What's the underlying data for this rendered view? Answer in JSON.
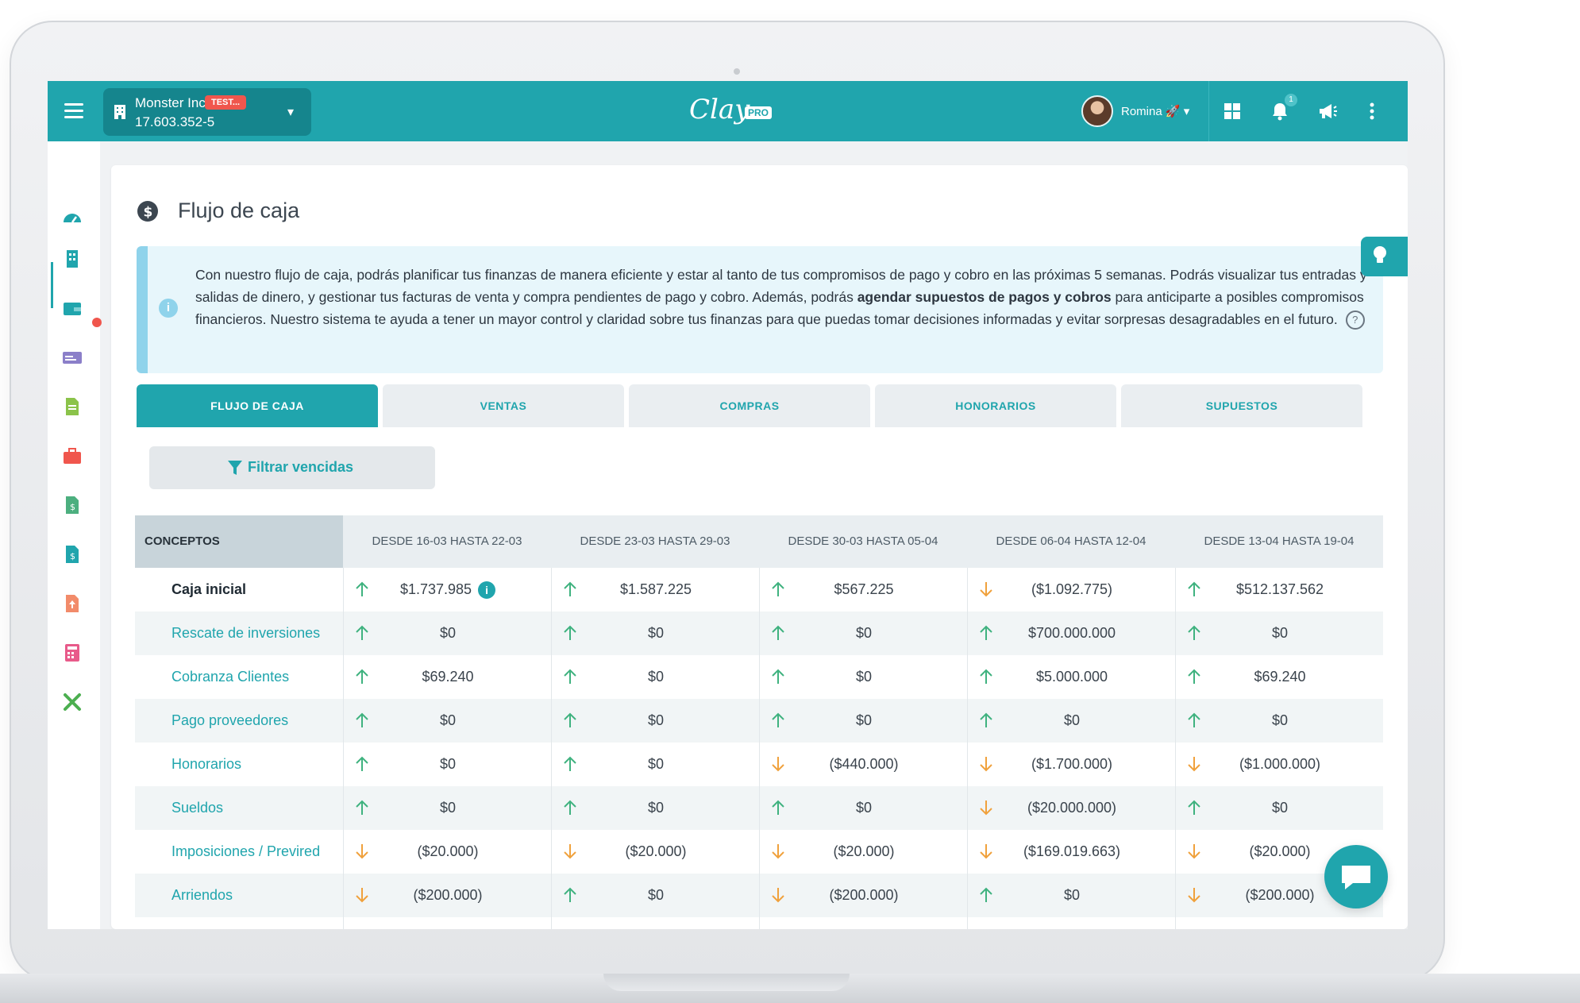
{
  "colors": {
    "primary": "#20a5ad",
    "up_arrow": "#3fb27f",
    "down_arrow": "#f0a13c",
    "badge_test": "#f0564d"
  },
  "topbar": {
    "company_name": "Monster Inc.",
    "company_rut": "17.603.352-5",
    "company_badge": "TEST...",
    "logo_word": "Clay",
    "logo_badge": "PRO",
    "user_name": "Romina",
    "user_suffix": "🚀",
    "notifications_count": "1",
    "icons": [
      "menu-icon",
      "building-icon",
      "chevron-down-icon",
      "grid-icon",
      "bell-icon",
      "megaphone-icon",
      "more-vertical-icon"
    ]
  },
  "sidebar": {
    "icons": [
      "dashboard-icon",
      "building-icon",
      "wallet-icon",
      "money-card-icon",
      "document-icon",
      "briefcase-icon",
      "invoice-icon",
      "invoice-dollar-icon",
      "upload-file-icon",
      "calculator-icon",
      "tools-icon"
    ]
  },
  "page": {
    "title": "Flujo de caja",
    "info_text_1": "Con nuestro flujo de caja, podrás planificar tus finanzas de manera eficiente y estar al tanto de tus compromisos de pago y cobro en las próximas 5 semanas. Podrás visualizar tus entradas y salidas de dinero, y gestionar tus facturas de venta y compra pendientes de pago y cobro. Además, podrás ",
    "info_text_bold": "agendar supuestos de pagos y cobros",
    "info_text_2": " para anticiparte a posibles compromisos financieros. Nuestro sistema te ayuda a tener un mayor control y claridad sobre tus finanzas para que puedas tomar decisiones informadas y evitar sorpresas desagradables en el futuro.",
    "help_label": "?",
    "info_icon_label": "i"
  },
  "tabs": [
    "FLUJO DE CAJA",
    "VENTAS",
    "COMPRAS",
    "HONORARIOS",
    "SUPUESTOS"
  ],
  "filter_button": "Filtrar vencidas",
  "table": {
    "first_header": "CONCEPTOS",
    "periods": [
      "DESDE 16-03 HASTA 22-03",
      "DESDE 23-03 HASTA 29-03",
      "DESDE 30-03 HASTA 05-04",
      "DESDE 06-04 HASTA 12-04",
      "DESDE 13-04 HASTA 19-04"
    ],
    "rows": [
      {
        "label": "Caja inicial",
        "bold": true,
        "cells": [
          {
            "dir": "up",
            "value": "$1.737.985",
            "info": true
          },
          {
            "dir": "up",
            "value": "$1.587.225"
          },
          {
            "dir": "up",
            "value": "$567.225"
          },
          {
            "dir": "down",
            "value": "($1.092.775)"
          },
          {
            "dir": "up",
            "value": "$512.137.562"
          }
        ]
      },
      {
        "label": "Rescate de inversiones",
        "cells": [
          {
            "dir": "up",
            "value": "$0"
          },
          {
            "dir": "up",
            "value": "$0"
          },
          {
            "dir": "up",
            "value": "$0"
          },
          {
            "dir": "up",
            "value": "$700.000.000"
          },
          {
            "dir": "up",
            "value": "$0"
          }
        ]
      },
      {
        "label": "Cobranza Clientes",
        "cells": [
          {
            "dir": "up",
            "value": "$69.240"
          },
          {
            "dir": "up",
            "value": "$0"
          },
          {
            "dir": "up",
            "value": "$0"
          },
          {
            "dir": "up",
            "value": "$5.000.000"
          },
          {
            "dir": "up",
            "value": "$69.240"
          }
        ]
      },
      {
        "label": "Pago proveedores",
        "cells": [
          {
            "dir": "up",
            "value": "$0"
          },
          {
            "dir": "up",
            "value": "$0"
          },
          {
            "dir": "up",
            "value": "$0"
          },
          {
            "dir": "up",
            "value": "$0"
          },
          {
            "dir": "up",
            "value": "$0"
          }
        ]
      },
      {
        "label": "Honorarios",
        "cells": [
          {
            "dir": "up",
            "value": "$0"
          },
          {
            "dir": "up",
            "value": "$0"
          },
          {
            "dir": "down",
            "value": "($440.000)"
          },
          {
            "dir": "down",
            "value": "($1.700.000)"
          },
          {
            "dir": "down",
            "value": "($1.000.000)"
          }
        ]
      },
      {
        "label": "Sueldos",
        "cells": [
          {
            "dir": "up",
            "value": "$0"
          },
          {
            "dir": "up",
            "value": "$0"
          },
          {
            "dir": "up",
            "value": "$0"
          },
          {
            "dir": "down",
            "value": "($20.000.000)"
          },
          {
            "dir": "up",
            "value": "$0"
          }
        ]
      },
      {
        "label": "Imposiciones / Previred",
        "cells": [
          {
            "dir": "down",
            "value": "($20.000)"
          },
          {
            "dir": "down",
            "value": "($20.000)"
          },
          {
            "dir": "down",
            "value": "($20.000)"
          },
          {
            "dir": "down",
            "value": "($169.019.663)"
          },
          {
            "dir": "down",
            "value": "($20.000)"
          }
        ]
      },
      {
        "label": "Arriendos",
        "cells": [
          {
            "dir": "down",
            "value": "($200.000)"
          },
          {
            "dir": "up",
            "value": "$0"
          },
          {
            "dir": "down",
            "value": "($200.000)"
          },
          {
            "dir": "up",
            "value": "$0"
          },
          {
            "dir": "down",
            "value": "($200.000)"
          }
        ]
      }
    ]
  }
}
